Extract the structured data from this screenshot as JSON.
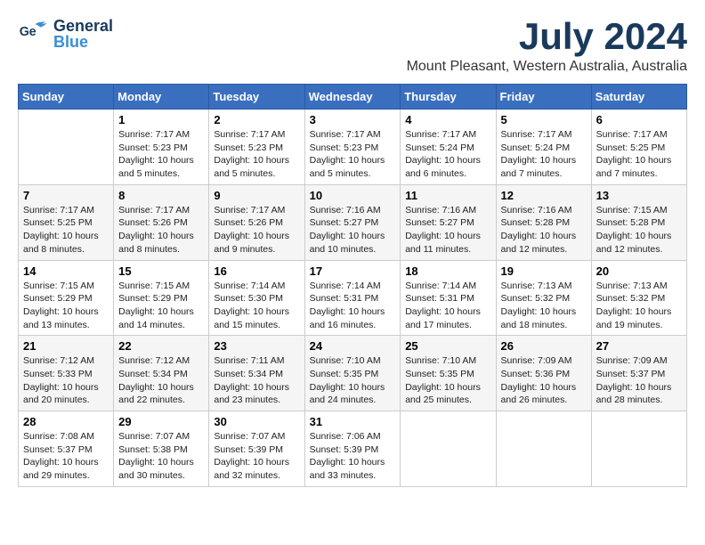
{
  "header": {
    "logo_general": "General",
    "logo_blue": "Blue",
    "month": "July 2024",
    "location": "Mount Pleasant, Western Australia, Australia"
  },
  "weekdays": [
    "Sunday",
    "Monday",
    "Tuesday",
    "Wednesday",
    "Thursday",
    "Friday",
    "Saturday"
  ],
  "weeks": [
    [
      {
        "day": "",
        "info": ""
      },
      {
        "day": "1",
        "info": "Sunrise: 7:17 AM\nSunset: 5:23 PM\nDaylight: 10 hours\nand 5 minutes."
      },
      {
        "day": "2",
        "info": "Sunrise: 7:17 AM\nSunset: 5:23 PM\nDaylight: 10 hours\nand 5 minutes."
      },
      {
        "day": "3",
        "info": "Sunrise: 7:17 AM\nSunset: 5:23 PM\nDaylight: 10 hours\nand 5 minutes."
      },
      {
        "day": "4",
        "info": "Sunrise: 7:17 AM\nSunset: 5:24 PM\nDaylight: 10 hours\nand 6 minutes."
      },
      {
        "day": "5",
        "info": "Sunrise: 7:17 AM\nSunset: 5:24 PM\nDaylight: 10 hours\nand 7 minutes."
      },
      {
        "day": "6",
        "info": "Sunrise: 7:17 AM\nSunset: 5:25 PM\nDaylight: 10 hours\nand 7 minutes."
      }
    ],
    [
      {
        "day": "7",
        "info": "Sunrise: 7:17 AM\nSunset: 5:25 PM\nDaylight: 10 hours\nand 8 minutes."
      },
      {
        "day": "8",
        "info": "Sunrise: 7:17 AM\nSunset: 5:26 PM\nDaylight: 10 hours\nand 8 minutes."
      },
      {
        "day": "9",
        "info": "Sunrise: 7:17 AM\nSunset: 5:26 PM\nDaylight: 10 hours\nand 9 minutes."
      },
      {
        "day": "10",
        "info": "Sunrise: 7:16 AM\nSunset: 5:27 PM\nDaylight: 10 hours\nand 10 minutes."
      },
      {
        "day": "11",
        "info": "Sunrise: 7:16 AM\nSunset: 5:27 PM\nDaylight: 10 hours\nand 11 minutes."
      },
      {
        "day": "12",
        "info": "Sunrise: 7:16 AM\nSunset: 5:28 PM\nDaylight: 10 hours\nand 12 minutes."
      },
      {
        "day": "13",
        "info": "Sunrise: 7:15 AM\nSunset: 5:28 PM\nDaylight: 10 hours\nand 12 minutes."
      }
    ],
    [
      {
        "day": "14",
        "info": "Sunrise: 7:15 AM\nSunset: 5:29 PM\nDaylight: 10 hours\nand 13 minutes."
      },
      {
        "day": "15",
        "info": "Sunrise: 7:15 AM\nSunset: 5:29 PM\nDaylight: 10 hours\nand 14 minutes."
      },
      {
        "day": "16",
        "info": "Sunrise: 7:14 AM\nSunset: 5:30 PM\nDaylight: 10 hours\nand 15 minutes."
      },
      {
        "day": "17",
        "info": "Sunrise: 7:14 AM\nSunset: 5:31 PM\nDaylight: 10 hours\nand 16 minutes."
      },
      {
        "day": "18",
        "info": "Sunrise: 7:14 AM\nSunset: 5:31 PM\nDaylight: 10 hours\nand 17 minutes."
      },
      {
        "day": "19",
        "info": "Sunrise: 7:13 AM\nSunset: 5:32 PM\nDaylight: 10 hours\nand 18 minutes."
      },
      {
        "day": "20",
        "info": "Sunrise: 7:13 AM\nSunset: 5:32 PM\nDaylight: 10 hours\nand 19 minutes."
      }
    ],
    [
      {
        "day": "21",
        "info": "Sunrise: 7:12 AM\nSunset: 5:33 PM\nDaylight: 10 hours\nand 20 minutes."
      },
      {
        "day": "22",
        "info": "Sunrise: 7:12 AM\nSunset: 5:34 PM\nDaylight: 10 hours\nand 22 minutes."
      },
      {
        "day": "23",
        "info": "Sunrise: 7:11 AM\nSunset: 5:34 PM\nDaylight: 10 hours\nand 23 minutes."
      },
      {
        "day": "24",
        "info": "Sunrise: 7:10 AM\nSunset: 5:35 PM\nDaylight: 10 hours\nand 24 minutes."
      },
      {
        "day": "25",
        "info": "Sunrise: 7:10 AM\nSunset: 5:35 PM\nDaylight: 10 hours\nand 25 minutes."
      },
      {
        "day": "26",
        "info": "Sunrise: 7:09 AM\nSunset: 5:36 PM\nDaylight: 10 hours\nand 26 minutes."
      },
      {
        "day": "27",
        "info": "Sunrise: 7:09 AM\nSunset: 5:37 PM\nDaylight: 10 hours\nand 28 minutes."
      }
    ],
    [
      {
        "day": "28",
        "info": "Sunrise: 7:08 AM\nSunset: 5:37 PM\nDaylight: 10 hours\nand 29 minutes."
      },
      {
        "day": "29",
        "info": "Sunrise: 7:07 AM\nSunset: 5:38 PM\nDaylight: 10 hours\nand 30 minutes."
      },
      {
        "day": "30",
        "info": "Sunrise: 7:07 AM\nSunset: 5:39 PM\nDaylight: 10 hours\nand 32 minutes."
      },
      {
        "day": "31",
        "info": "Sunrise: 7:06 AM\nSunset: 5:39 PM\nDaylight: 10 hours\nand 33 minutes."
      },
      {
        "day": "",
        "info": ""
      },
      {
        "day": "",
        "info": ""
      },
      {
        "day": "",
        "info": ""
      }
    ]
  ]
}
